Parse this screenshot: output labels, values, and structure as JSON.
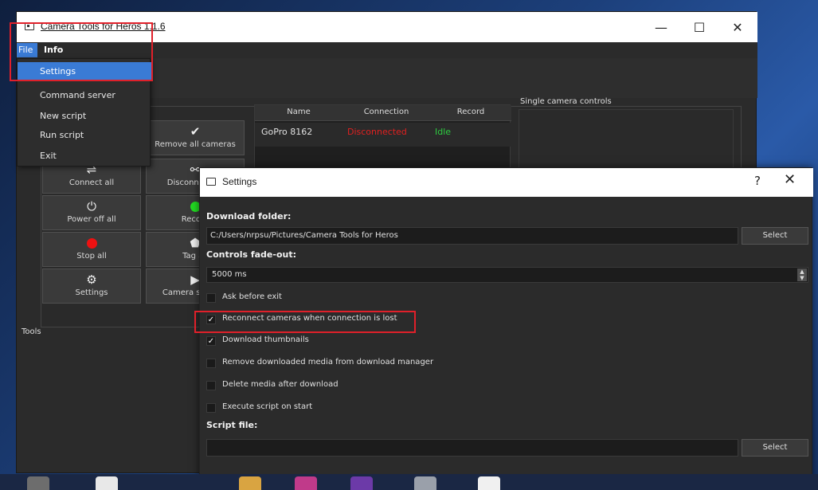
{
  "main_window": {
    "title": "Camera Tools for Heros 1.1.6",
    "controls": {
      "minimize": "—",
      "maximize": "☐",
      "close": "✕"
    }
  },
  "menu": {
    "file": "File",
    "info": "Info",
    "items": [
      "Settings",
      "Command server",
      "New script",
      "Run script",
      "Exit"
    ]
  },
  "controls": {
    "buttons": [
      {
        "label": "Remove all cameras",
        "icon": "✔"
      },
      {
        "label": "Connect all",
        "icon": "⇌"
      },
      {
        "label": "Disconnect all",
        "icon": "⚯"
      },
      {
        "label": "Power off all",
        "icon": "⏻"
      },
      {
        "label": "Record",
        "icon": "●"
      },
      {
        "label": "Stop all",
        "icon": "●"
      },
      {
        "label": "Tag all",
        "icon": "⬟"
      },
      {
        "label": "Settings",
        "icon": "⚙"
      },
      {
        "label": "Camera settings",
        "icon": "▶"
      }
    ]
  },
  "camera_table": {
    "headers": [
      "Name",
      "Connection",
      "Record"
    ],
    "rows": [
      {
        "name": "GoPro 8162",
        "connection": "Disconnected",
        "record": "Idle"
      }
    ]
  },
  "single_camera_label": "Single camera controls",
  "tools_label": "Tools",
  "settings_dialog": {
    "title": "Settings",
    "help": "?",
    "close": "✕",
    "download_folder_label": "Download folder:",
    "download_folder_value": "C:/Users/nrpsu/Pictures/Camera Tools for Heros",
    "select_label": "Select",
    "fade_out_label": "Controls fade-out:",
    "fade_out_value": "5000 ms",
    "checkboxes": [
      {
        "label": "Ask before exit",
        "checked": false
      },
      {
        "label": "Reconnect cameras when connection is lost",
        "checked": true
      },
      {
        "label": "Download thumbnails",
        "checked": true
      },
      {
        "label": "Remove downloaded media from download manager",
        "checked": false
      },
      {
        "label": "Delete media after download",
        "checked": false
      },
      {
        "label": "Execute script on start",
        "checked": false
      }
    ],
    "script_file_label": "Script file:",
    "script_file_value": ""
  },
  "colors": {
    "accent": "#3a7bd5",
    "highlight": "#e0202a",
    "disconnected": "#e02020",
    "idle": "#2ecc40",
    "record_dot": "#22dd22",
    "stop_dot": "#ee1111"
  }
}
